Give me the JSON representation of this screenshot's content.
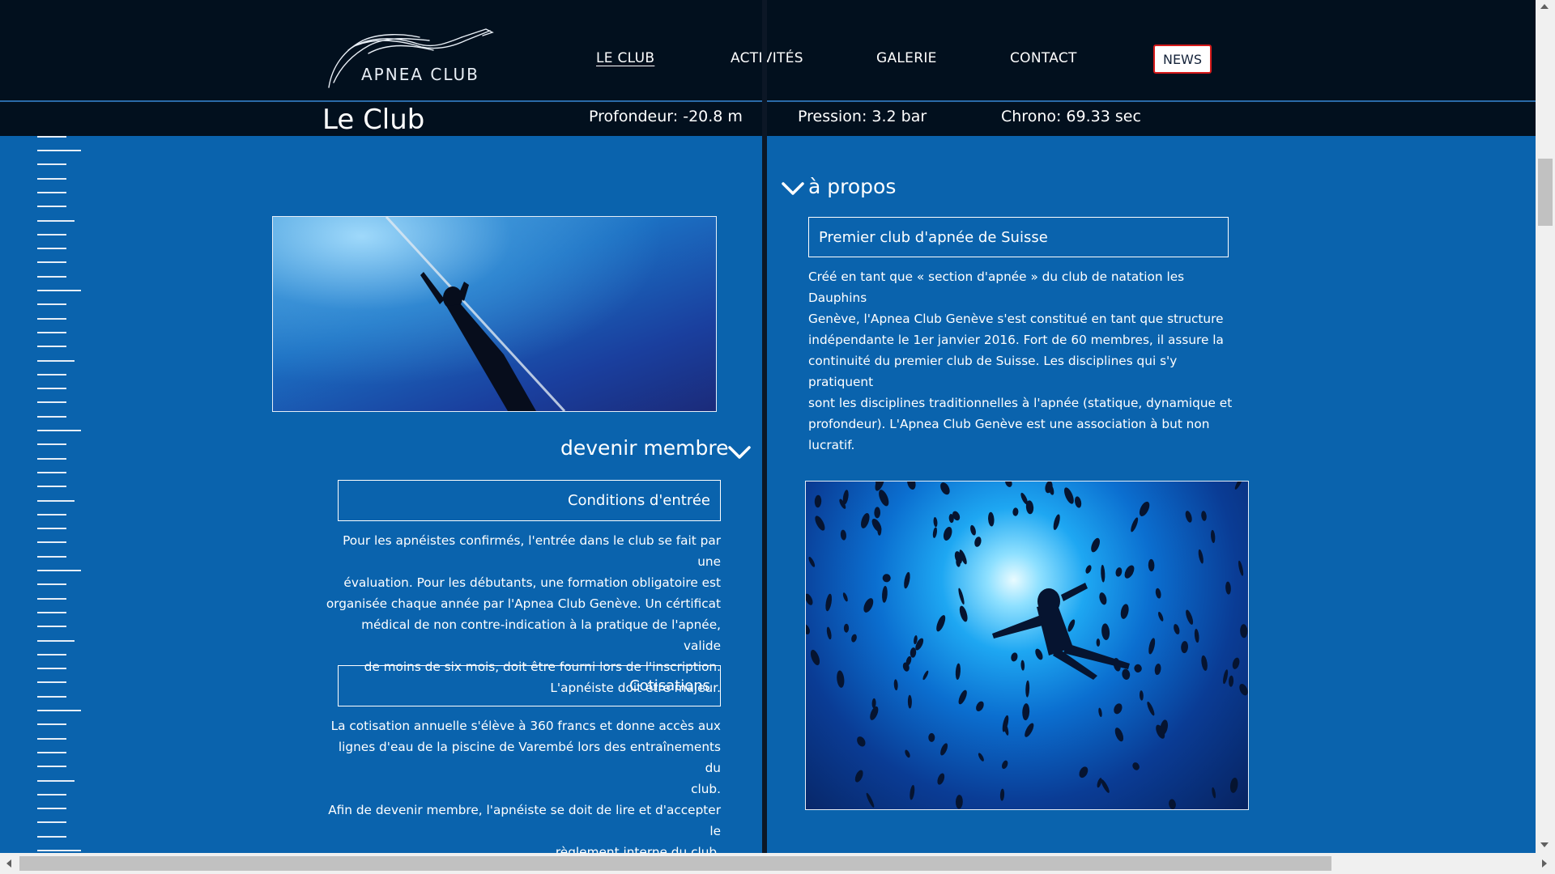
{
  "brand": {
    "logo_text": "APNEA CLUB"
  },
  "nav": {
    "items": [
      {
        "label": "LE CLUB"
      },
      {
        "label": "ACTIVITÉS"
      },
      {
        "label": "GALERIE"
      },
      {
        "label": "CONTACT"
      }
    ],
    "news": "NEWS"
  },
  "subheader": {
    "title": "Le Club",
    "profondeur": "Profondeur: -20.8 m",
    "pression": "Pression: 3.2 bar",
    "chrono": "Chrono: 69.33 sec"
  },
  "left": {
    "heading": "devenir membre",
    "conditions": {
      "title": "Conditions d'entrée",
      "lines": [
        "Pour les apnéistes confirmés, l'entrée dans le club se fait par une",
        "évaluation. Pour les débutants, une formation obligatoire est",
        "organisée chaque année par l'Apnea Club Genève. Un cértificat",
        "médical de non contre-indication à la pratique de l'apnée, valide",
        "de moins de six mois, doit être fourni lors de l'inscription.",
        "L'apnéiste doit être majeur."
      ]
    },
    "cotisations": {
      "title": "Cotisations",
      "lines": [
        "La cotisation annuelle s'élève à 360 francs et donne accès aux",
        "lignes d'eau de la piscine de Varembé lors des entraînements du",
        "club.",
        "Afin de devenir membre, l'apnéiste se doit de lire et d'accepter le",
        "règlement interne du club."
      ]
    }
  },
  "right": {
    "heading": "à propos",
    "box_title": "Premier club d'apnée de Suisse",
    "lines": [
      "Créé en tant que « section d'apnée » du club de natation les Dauphins",
      "Genève, l'Apnea Club Genève s'est constitué en tant que structure",
      "indépendante le 1er janvier 2016. Fort de 60 membres, il assure la",
      "continuité du premier club de Suisse. Les disciplines qui s'y pratiquent",
      "sont les disciplines traditionnelles à l'apnée (statique, dynamique et",
      "profondeur). L'Apnea Club Genève est une association à but non",
      "lucratif."
    ]
  }
}
